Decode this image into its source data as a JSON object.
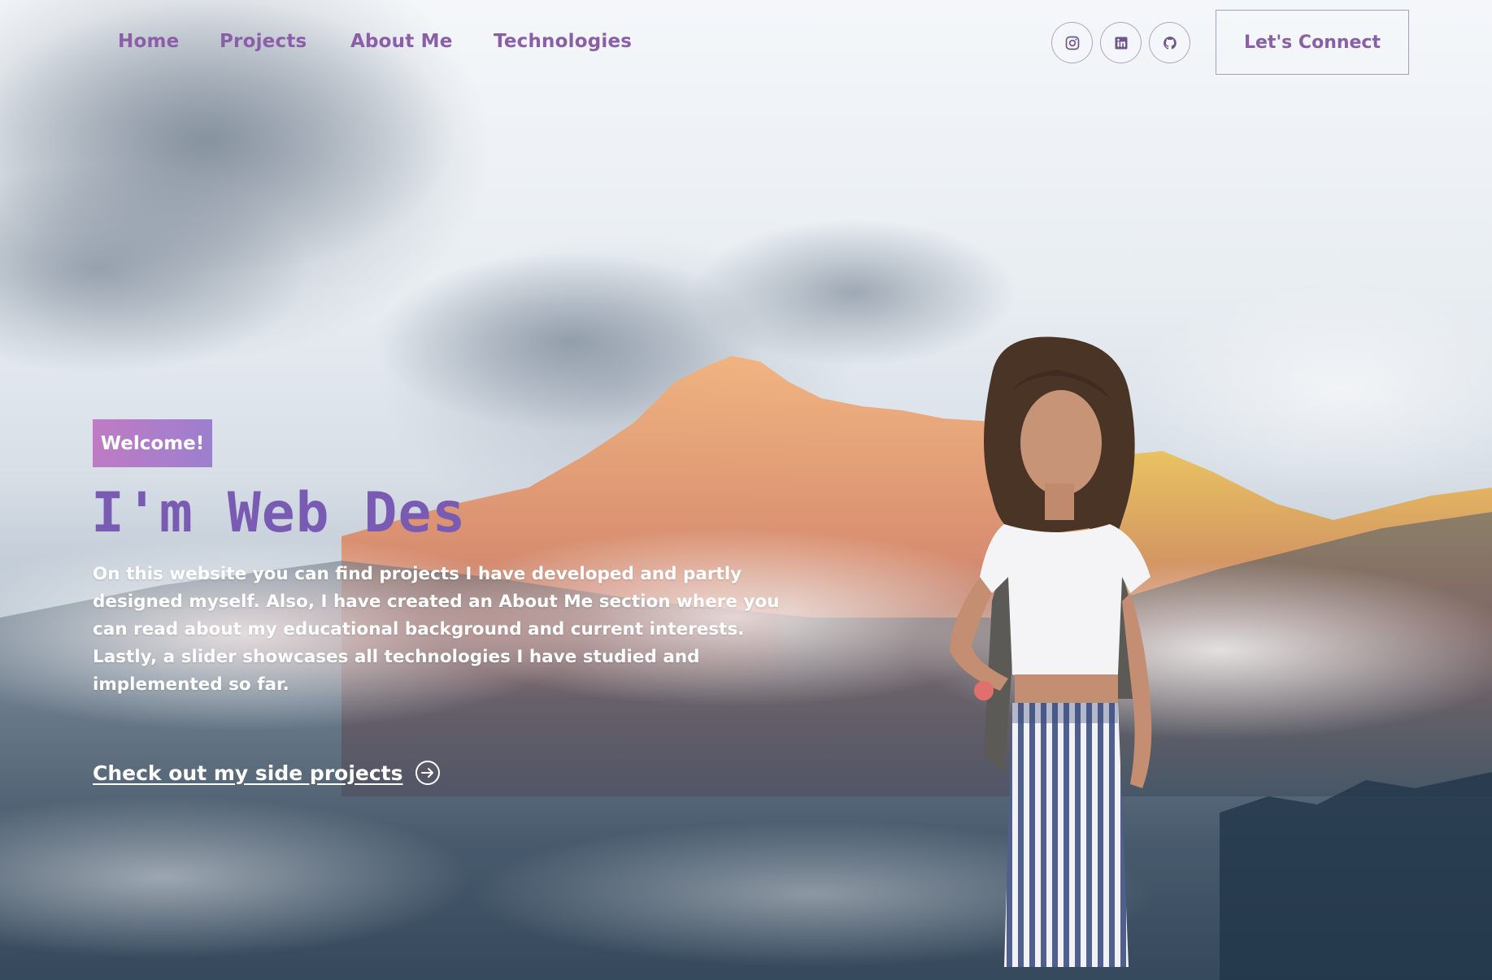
{
  "nav": {
    "links": [
      "Home",
      "Projects",
      "About Me",
      "Technologies"
    ],
    "social_icons": [
      "instagram-icon",
      "linkedin-icon",
      "github-icon"
    ],
    "connect_label": "Let's Connect"
  },
  "hero": {
    "badge": "Welcome!",
    "headline": "I'm Web Des",
    "description": "On this website you can find projects I have developed and partly designed myself. Also, I have created an About Me section where you can read about my educational background and current interests. Lastly, a slider showcases all technologies I have studied and implemented so far.",
    "cta_label": "Check out my side projects",
    "cta_icon": "arrow-right-circle-icon"
  },
  "colors": {
    "accent": "#8a5fa8",
    "headline": "#7a5bb4",
    "badge_start": "#c07bc4",
    "badge_end": "#9c7fcf"
  }
}
